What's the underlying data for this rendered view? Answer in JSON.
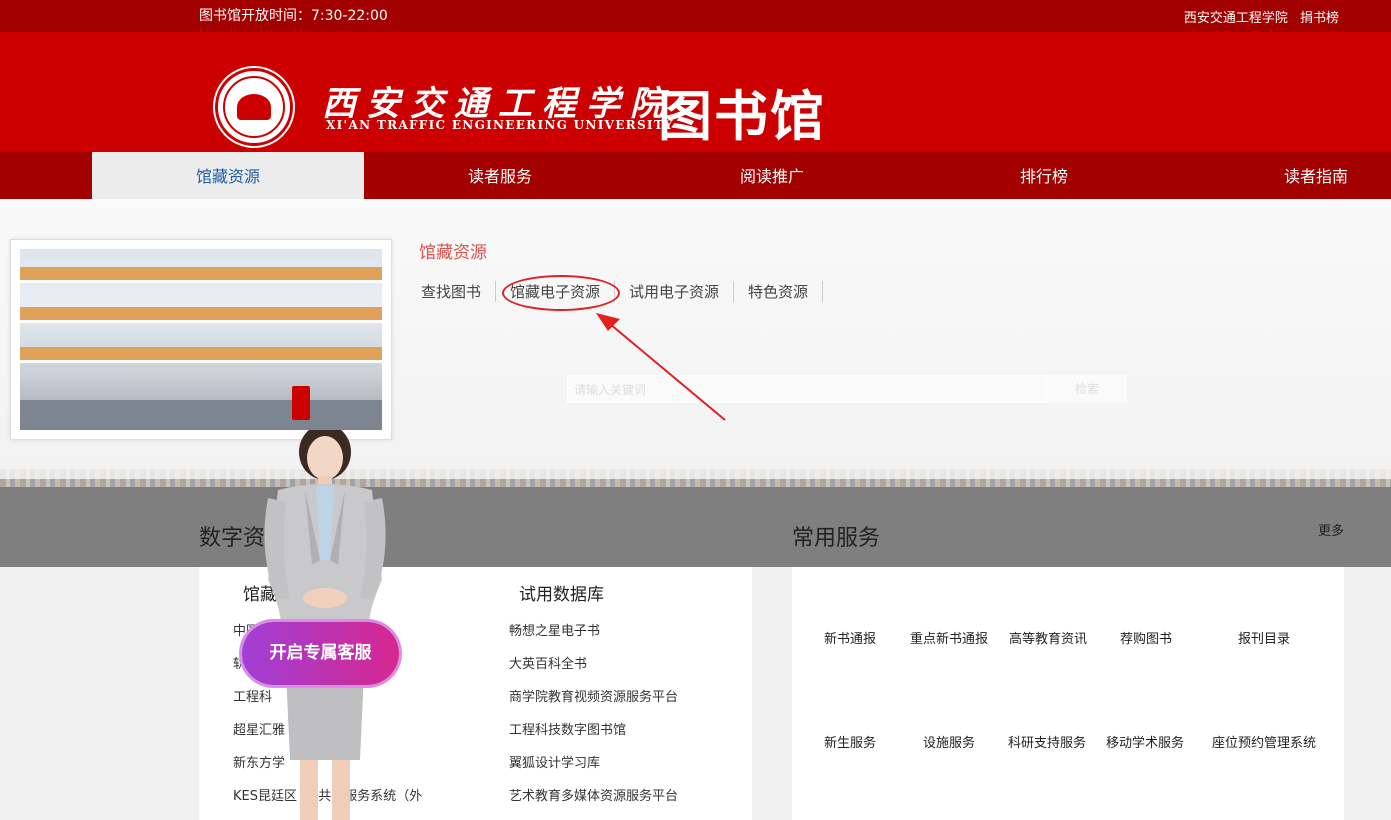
{
  "topbar": {
    "hours": "图书馆开放时间：7:30-22:00",
    "links": [
      "西安交通工程学院",
      "捐书榜"
    ]
  },
  "header": {
    "school_name_cn": "西安交通工程学院",
    "school_name_en": "XI'AN TRAFFIC ENGINEERING UNIVERSITY",
    "library_title": "图书馆"
  },
  "nav": {
    "items": [
      "馆藏资源",
      "读者服务",
      "阅读推广",
      "排行榜",
      "读者指南"
    ],
    "active": "馆藏资源"
  },
  "dropdown": {
    "title": "馆藏资源",
    "links": [
      "查找图书",
      "馆藏电子资源",
      "试用电子资源",
      "特色资源"
    ],
    "highlighted": "馆藏电子资源",
    "search_placeholder": "请输入关键词",
    "search_button": "检索"
  },
  "digital_resources": {
    "title": "数字资",
    "col1": {
      "title": "馆藏",
      "items": [
        "中国知",
        "轨",
        "工程科",
        "超星汇雅",
        "新东方学",
        "KES昆廷区 资 共享服务系统（外"
      ]
    },
    "col2": {
      "title": "试用数据库",
      "items": [
        "畅想之星电子书",
        "大英百科全书",
        "商学院教育视频资源服务平台",
        "工程科技数字图书馆",
        "翼狐设计学习库",
        "艺术教育多媒体资源服务平台"
      ]
    }
  },
  "common_services": {
    "title": "常用服务",
    "more": "更多",
    "row1": [
      "新书通报",
      "重点新书通报",
      "高等教育资讯",
      "荐购图书",
      "报刊目录"
    ],
    "row2": [
      "新生服务",
      "设施服务",
      "科研支持服务",
      "移动学术服务",
      "座位预约管理系统"
    ]
  },
  "assistant": {
    "button_label": "开启专属客服"
  },
  "colors": {
    "brand_red": "#cc0000",
    "dark_red": "#a30000",
    "nav_active_text": "#1f5fa8",
    "dropdown_title": "#d9534f",
    "annotation": "#e02020"
  }
}
